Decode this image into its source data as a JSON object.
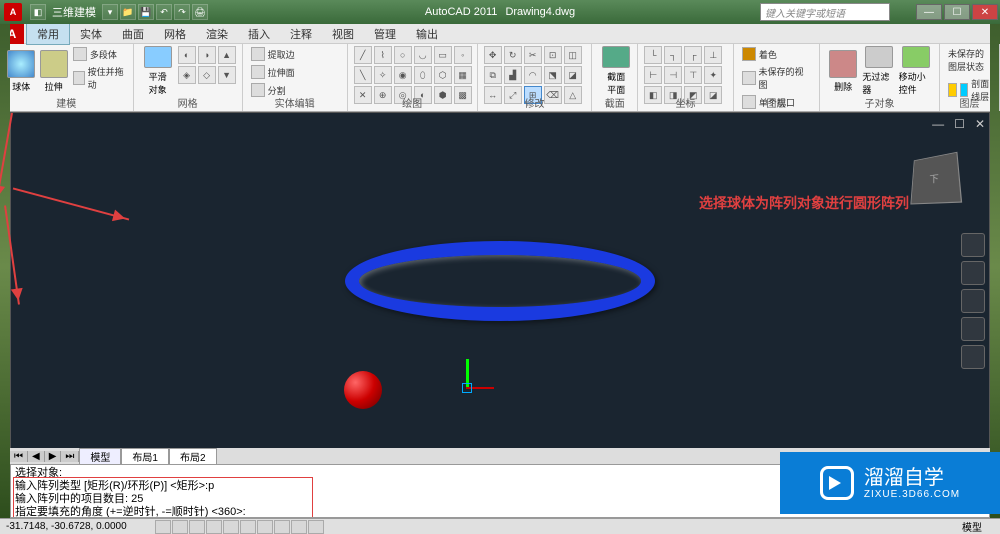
{
  "title": {
    "app": "AutoCAD 2011",
    "doc": "Drawing4.dwg",
    "workspace": "三维建模"
  },
  "search": {
    "placeholder": "键入关键字或短语"
  },
  "menu": {
    "tabs": [
      "常用",
      "实体",
      "曲面",
      "网格",
      "渲染",
      "插入",
      "注释",
      "视图",
      "管理",
      "输出"
    ]
  },
  "ribbon": {
    "panels": [
      "建模",
      "网格",
      "实体编辑",
      "绘图",
      "修改",
      "截面",
      "坐标",
      "图层",
      "子对象",
      "图层"
    ],
    "model": {
      "sphere": "球体",
      "extrude": "拉伸",
      "polysolid": "多段体",
      "presspull": "按住并拖动"
    },
    "mesh": {
      "smooth": "平滑\n对象",
      "edge": "提取边",
      "stretch": "拉伸面",
      "split": "分割"
    },
    "section": {
      "plane": "截面\n平面"
    },
    "layer": {
      "color_label": "着色",
      "unsaved": "未保存的视图",
      "viewport": "单个视口"
    },
    "subobj": {
      "delete": "删除",
      "nofilter": "无过滤器",
      "gizmo": "移动小控件"
    },
    "layerstate": {
      "unsaved_layer": "未保存的图层状态",
      "section_line": "剖面线层"
    }
  },
  "annotation": {
    "text": "选择球体为阵列对象进行圆形阵列"
  },
  "sheets": {
    "model": "模型",
    "layout1": "布局1",
    "layout2": "布局2"
  },
  "command": {
    "l1": "选择对象:",
    "l2": "输入阵列类型 [矩形(R)/环形(P)] <矩形>:p",
    "l3": "输入阵列中的项目数目: 25",
    "l4": "指定要填充的角度 (+=逆时针, -=顺时针) <360>:"
  },
  "status": {
    "coords": "-31.7148, -30.6728, 0.0000",
    "mode": "模型"
  },
  "watermark": {
    "title": "溜溜自学",
    "url": "ZIXUE.3D66.COM"
  }
}
